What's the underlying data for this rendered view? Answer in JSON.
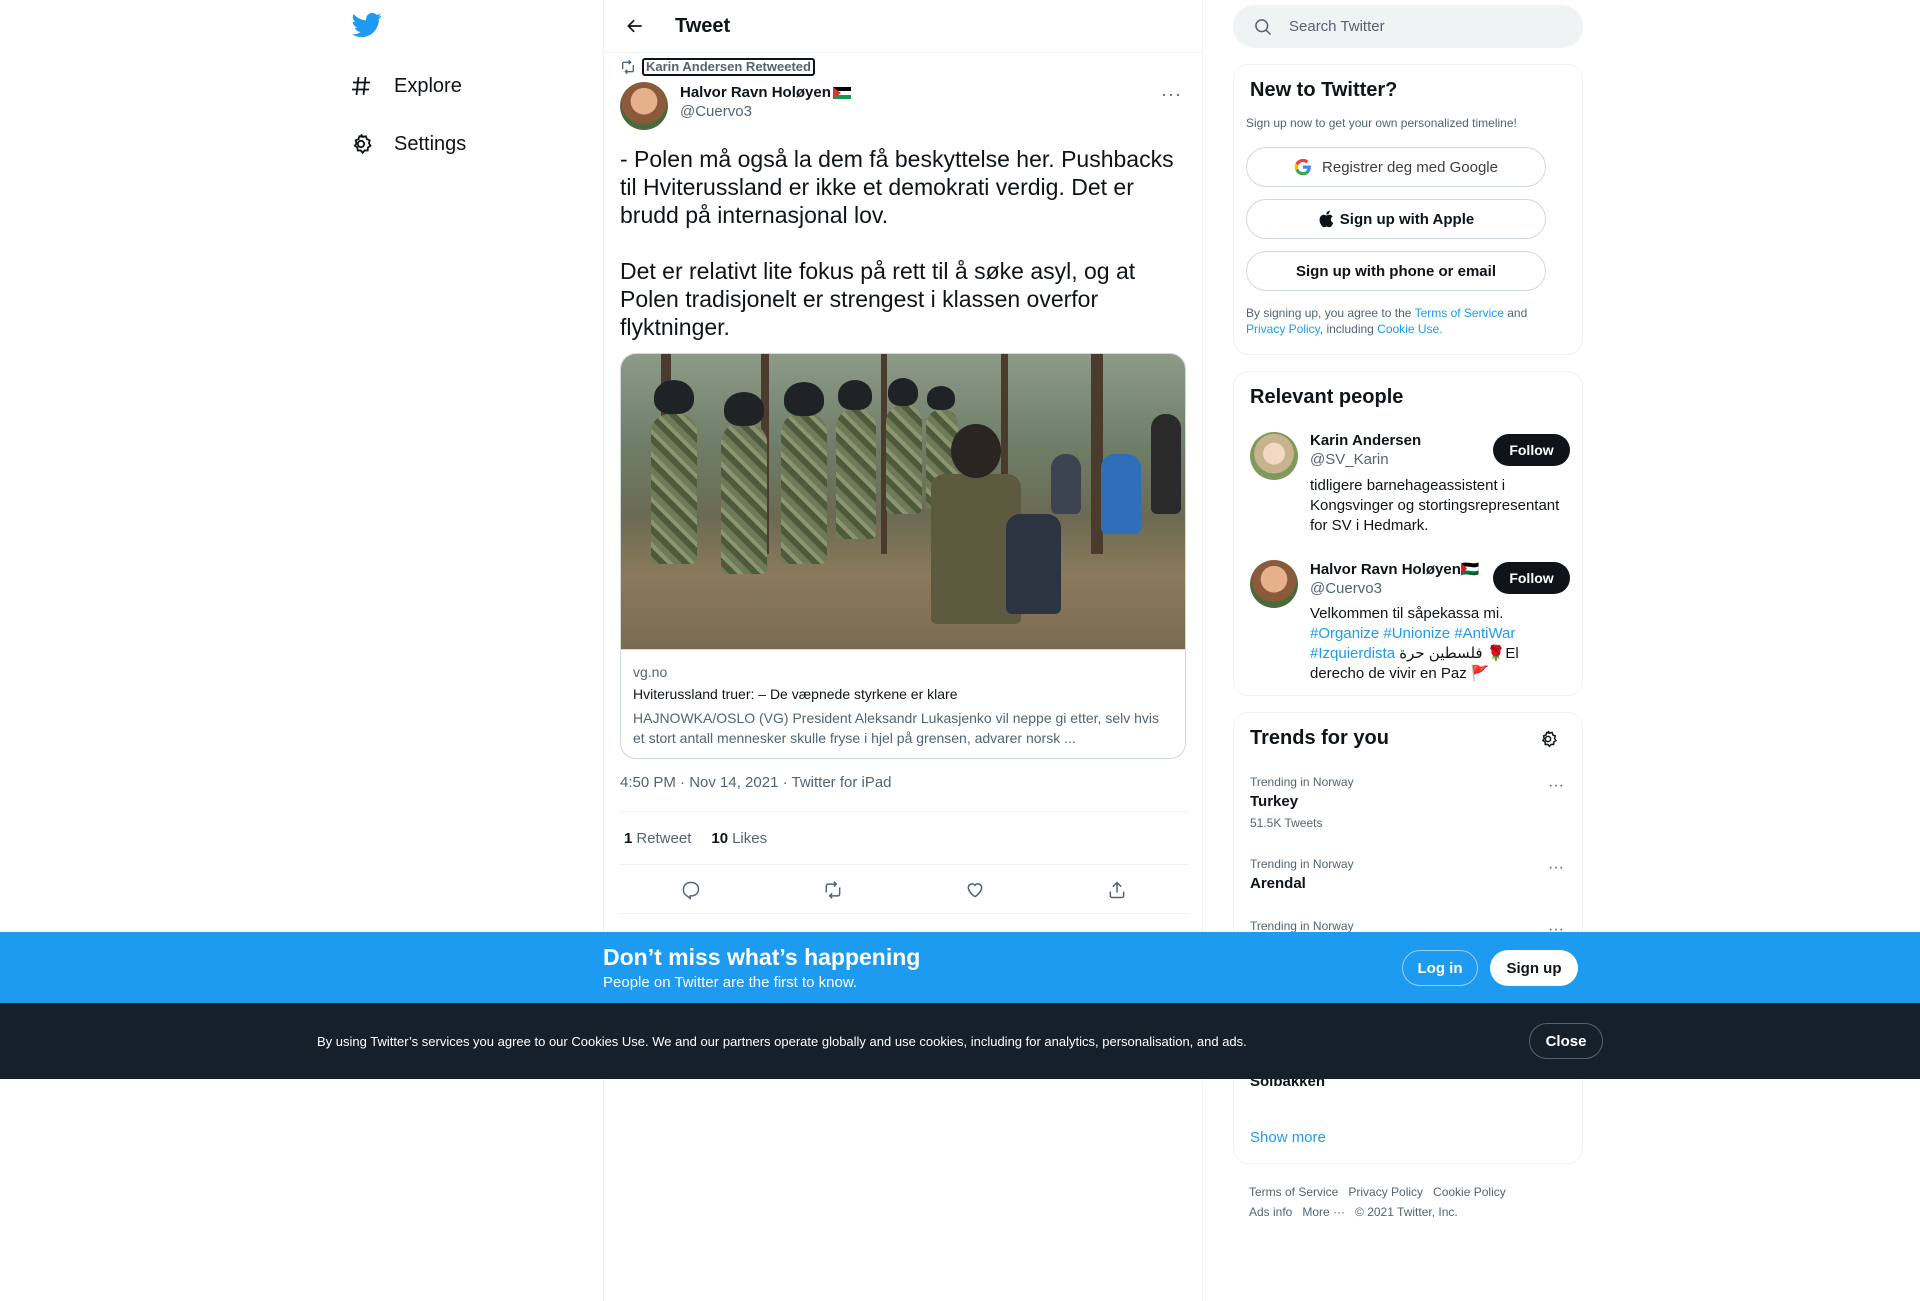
{
  "nav": {
    "logo": "twitter-bird-icon",
    "items": [
      {
        "label": "Explore",
        "icon": "hashtag-icon"
      },
      {
        "label": "Settings",
        "icon": "gear-icon"
      }
    ]
  },
  "header": {
    "title": "Tweet"
  },
  "tweet": {
    "retweeted_by": "Karin Andersen Retweeted",
    "author_name": "Halvor Ravn Holøyen",
    "author_handle": "@Cuervo3",
    "text": "- Polen må også la dem få beskyttelse her. Pushbacks til Hviterussland er ikke et demokrati verdig. Det er brudd på internasjonal lov.\n\nDet er relativt lite fokus på rett til å søke asyl, og at Polen tradisjonelt er strengest i klassen overfor flyktninger.",
    "card": {
      "domain": "vg.no",
      "title": "Hviterussland truer: – De væpnede styrkene er klare",
      "description": "HAJNOWKA/OSLO (VG) President Aleksandr Lukasjenko vil neppe gi etter, selv hvis et stort antall mennesker skulle fryse i hjel på grensen, advarer norsk ..."
    },
    "timestamp": "4:50 PM · Nov 14, 2021 · Twitter for iPad",
    "retweets": {
      "count": "1",
      "label": "Retweet"
    },
    "likes": {
      "count": "10",
      "label": "Likes"
    }
  },
  "search": {
    "placeholder": "Search Twitter"
  },
  "new_to_twitter": {
    "title": "New to Twitter?",
    "subtitle": "Sign up now to get your own personalized timeline!",
    "google_label": "Registrer deg med Google",
    "apple_label": "Sign up with Apple",
    "phone_label": "Sign up with phone or email",
    "terms_1": "By signing up, you agree to the ",
    "terms_link_1": "Terms of Service",
    "terms_2": " and ",
    "terms_link_2": "Privacy Policy",
    "terms_3": ", including ",
    "terms_link_3": "Cookie Use."
  },
  "relevant": {
    "title": "Relevant people",
    "people": [
      {
        "name": "Karin Andersen",
        "handle": "@SV_Karin",
        "bio": "tidligere barnehageassistent i Kongsvinger og stortingsrepresentant for SV i Hedmark.",
        "follow": "Follow"
      },
      {
        "name": "Halvor Ravn Holøyen🇵🇸",
        "handle": "@Cuervo3",
        "bio_text": "Velkommen til såpekassa mi.",
        "tags": "#Organize #Unionize #AntiWar #Izquierdista",
        "bio_tail": " فلسطين حرة 🌹El derecho de vivir en Paz 🚩",
        "follow": "Follow"
      }
    ]
  },
  "trends": {
    "title": "Trends for you",
    "items": [
      {
        "context": "Trending in Norway",
        "name": "Turkey",
        "count": "51.5K Tweets"
      },
      {
        "context": "Trending in Norway",
        "name": "Arendal",
        "count": ""
      },
      {
        "context": "Trending in Norway",
        "name": "",
        "count": ""
      },
      {
        "context": "",
        "name": "Solbakken",
        "count": ""
      }
    ],
    "show_more": "Show more"
  },
  "footer": {
    "links": [
      "Terms of Service",
      "Privacy Policy",
      "Cookie Policy",
      "Ads info",
      "More ···",
      "© 2021 Twitter, Inc."
    ]
  },
  "banner": {
    "title": "Don’t miss what’s happening",
    "subtitle": "People on Twitter are the first to know.",
    "login": "Log in",
    "signup": "Sign up"
  },
  "cookie": {
    "text": "By using Twitter’s services you agree to our Cookies Use. We and our partners operate globally and use cookies, including for analytics, personalisation, and ads.",
    "close": "Close"
  },
  "colors": {
    "accent": "#1d9bf0",
    "text": "#0f1419",
    "secondary": "#536471",
    "cookie_bg": "#15202b"
  }
}
